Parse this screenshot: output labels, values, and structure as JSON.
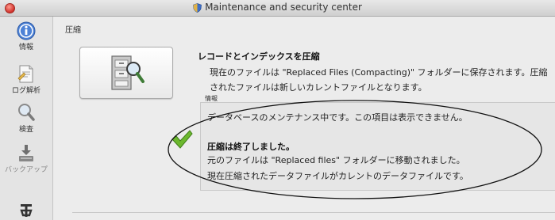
{
  "window": {
    "title": "Maintenance and security center"
  },
  "sidebar": {
    "items": [
      {
        "label": "情報",
        "icon": "info-icon"
      },
      {
        "label": "ログ解析",
        "icon": "log-icon"
      },
      {
        "label": "検査",
        "icon": "magnifier-icon"
      },
      {
        "label": "バックアップ",
        "icon": "backup-icon"
      },
      {
        "label": "",
        "icon": "repair-icon"
      }
    ]
  },
  "main": {
    "section_title": "圧縮",
    "action_button": {
      "icon": "compact-icon"
    },
    "heading": "レコードとインデックスを圧縮",
    "description": "現在のファイルは \"Replaced Files (Compacting)\" フォルダーに保存されます。圧縮されたファイルは新しいカレントファイルとなります。",
    "info_label": "情報",
    "info": {
      "line1": "データベースのメンテナンス中です。この項目は表示できません。",
      "status_bold": "圧縮は終了しました。",
      "line2": "元のファイルは \"Replaced files\" フォルダーに移動されました。",
      "line3": "現在圧縮されたデータファイルがカレントのデータファイルです。"
    },
    "status_icon": "checkmark-icon"
  },
  "colors": {
    "check": "#6cb82e",
    "close": "#d0302a"
  }
}
